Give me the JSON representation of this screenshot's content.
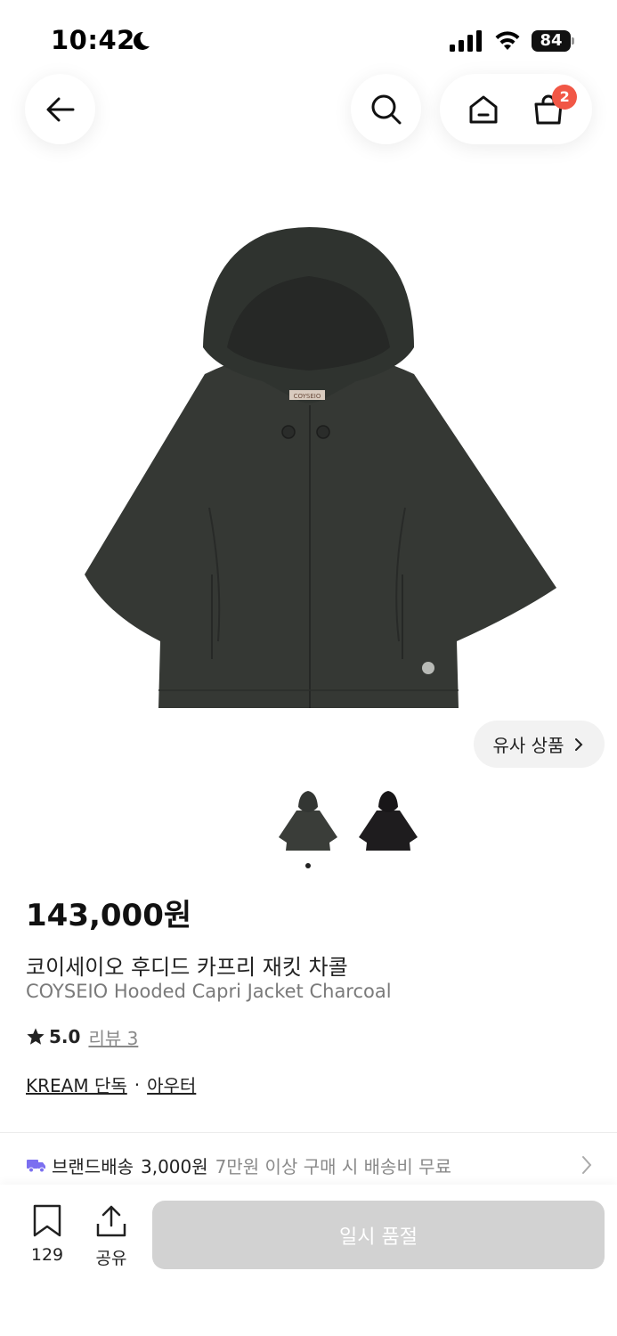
{
  "status_bar": {
    "time": "10:42",
    "battery": "84",
    "icons": [
      "moon-icon",
      "signal-icon",
      "wifi-icon",
      "battery-icon"
    ]
  },
  "nav": {
    "icons": [
      "back-arrow-icon",
      "search-icon",
      "home-icon",
      "cart-icon"
    ],
    "cart_badge": "2"
  },
  "product": {
    "similar_label": "유사 상품",
    "thumbnail_count": 2,
    "selected_thumbnail": 1,
    "thumbnail_colors": [
      "#3a3d39",
      "#1e1c1e"
    ],
    "price": "143,000원",
    "name_ko": "코이세이오 후디드 카프리 재킷 차콜",
    "name_en": "COYSEIO Hooded Capri Jacket Charcoal",
    "rating": "5.0",
    "review_link": "리뷰 3",
    "tags": [
      "KREAM 단독",
      "아우터"
    ],
    "tag_separator": "·",
    "jacket_label": "COYSEIO"
  },
  "shipping": {
    "label": "브랜드배송",
    "fee": "3,000원",
    "note": "7만원 이상 구매 시 배송비 무료"
  },
  "bottom_bar": {
    "bookmark_count": "129",
    "share_label": "공유",
    "soldout_label": "일시 품절"
  },
  "colors": {
    "badge": "#f15746",
    "truck": "#7b6ff0",
    "soldout_bg": "#d2d2d2"
  }
}
